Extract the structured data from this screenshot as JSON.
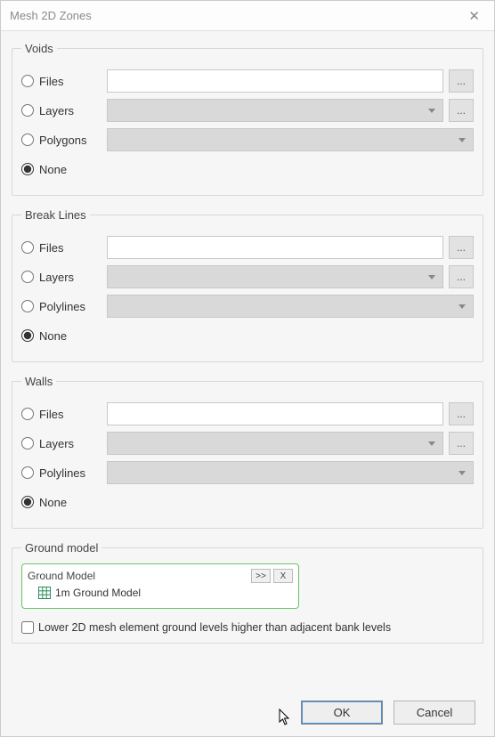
{
  "window": {
    "title": "Mesh 2D Zones"
  },
  "browse_label": "...",
  "voids": {
    "legend": "Voids",
    "files_label": "Files",
    "layers_label": "Layers",
    "polygons_label": "Polygons",
    "none_label": "None",
    "selected": "none",
    "files_value": "",
    "layers_value": "",
    "polygons_value": ""
  },
  "break_lines": {
    "legend": "Break Lines",
    "files_label": "Files",
    "layers_label": "Layers",
    "polylines_label": "Polylines",
    "none_label": "None",
    "selected": "none",
    "files_value": "",
    "layers_value": "",
    "polylines_value": ""
  },
  "walls": {
    "legend": "Walls",
    "files_label": "Files",
    "layers_label": "Layers",
    "polylines_label": "Polylines",
    "none_label": "None",
    "selected": "none",
    "files_value": "",
    "layers_value": "",
    "polylines_value": ""
  },
  "ground_model": {
    "legend": "Ground model",
    "box_title": "Ground Model",
    "expand_label": ">>",
    "remove_label": "X",
    "item_name": "1m Ground Model",
    "lower_checkbox_label": "Lower 2D mesh element ground levels higher than adjacent bank levels",
    "lower_checked": false
  },
  "buttons": {
    "ok": "OK",
    "cancel": "Cancel"
  }
}
